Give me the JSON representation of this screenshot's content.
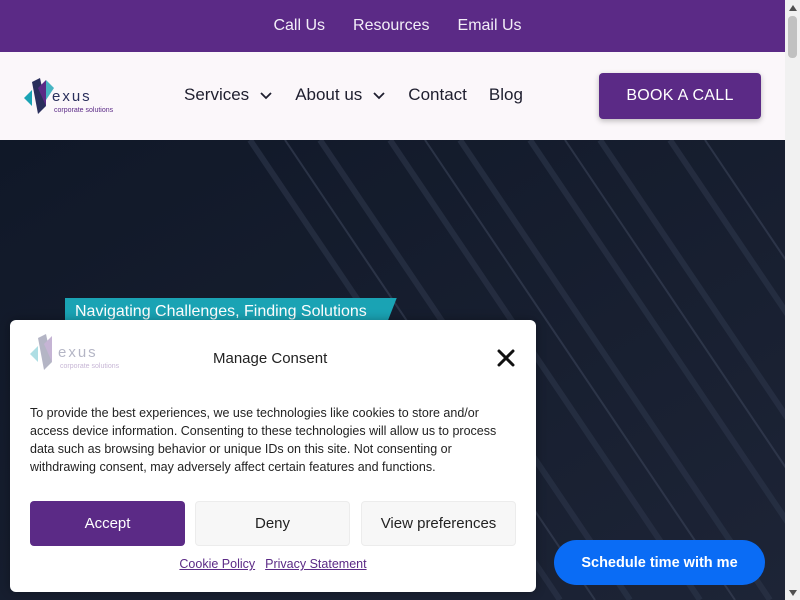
{
  "topbar": {
    "links": [
      "Call Us",
      "Resources",
      "Email Us"
    ]
  },
  "header": {
    "logo_text": "exus",
    "logo_sub": "corporate solutions",
    "nav": [
      {
        "label": "Services",
        "has_dropdown": true
      },
      {
        "label": "About us",
        "has_dropdown": true
      },
      {
        "label": "Contact",
        "has_dropdown": false
      },
      {
        "label": "Blog",
        "has_dropdown": false
      }
    ],
    "cta": "BOOK A CALL"
  },
  "hero": {
    "tagline": "Navigating Challenges, Finding Solutions"
  },
  "consent": {
    "logo_text": "exus",
    "logo_sub": "corporate solutions",
    "title": "Manage Consent",
    "body": "To provide the best experiences, we use technologies like cookies to store and/or access device information. Consenting to these technologies will allow us to process data such as browsing behavior or unique IDs on this site. Not consenting or withdrawing consent, may adversely affect certain features and functions.",
    "accept": "Accept",
    "deny": "Deny",
    "preferences": "View preferences",
    "cookie_policy": "Cookie Policy",
    "privacy": "Privacy Statement"
  },
  "schedule_button": "Schedule time with me",
  "colors": {
    "brand_purple": "#5b2a86",
    "teal": "#1aa3b4",
    "hero_bg": "#121a2c",
    "chat_blue": "#0a6cf5"
  }
}
